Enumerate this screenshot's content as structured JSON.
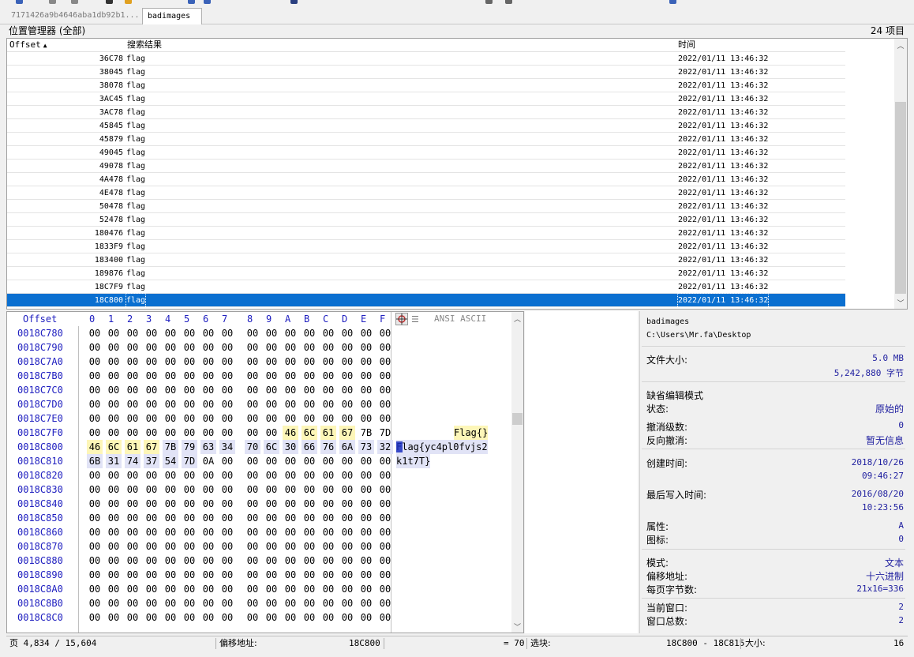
{
  "tabs": [
    {
      "label": "7171426a9b4646aba1db92b1..."
    },
    {
      "label": "badimages"
    }
  ],
  "position_manager": {
    "title": "位置管理器 (全部)",
    "count": "24 项目",
    "columns": [
      "Offset",
      "搜索结果",
      "时间"
    ],
    "rows": [
      {
        "offset": "36C78",
        "result": "flag",
        "time": "2022/01/11   13:46:32"
      },
      {
        "offset": "38045",
        "result": "flag",
        "time": "2022/01/11   13:46:32"
      },
      {
        "offset": "38078",
        "result": "flag",
        "time": "2022/01/11   13:46:32"
      },
      {
        "offset": "3AC45",
        "result": "flag",
        "time": "2022/01/11   13:46:32"
      },
      {
        "offset": "3AC78",
        "result": "flag",
        "time": "2022/01/11   13:46:32"
      },
      {
        "offset": "45845",
        "result": "flag",
        "time": "2022/01/11   13:46:32"
      },
      {
        "offset": "45879",
        "result": "flag",
        "time": "2022/01/11   13:46:32"
      },
      {
        "offset": "49045",
        "result": "flag",
        "time": "2022/01/11   13:46:32"
      },
      {
        "offset": "49078",
        "result": "flag",
        "time": "2022/01/11   13:46:32"
      },
      {
        "offset": "4A478",
        "result": "flag",
        "time": "2022/01/11   13:46:32"
      },
      {
        "offset": "4E478",
        "result": "flag",
        "time": "2022/01/11   13:46:32"
      },
      {
        "offset": "50478",
        "result": "flag",
        "time": "2022/01/11   13:46:32"
      },
      {
        "offset": "52478",
        "result": "flag",
        "time": "2022/01/11   13:46:32"
      },
      {
        "offset": "180476",
        "result": "flag",
        "time": "2022/01/11   13:46:32"
      },
      {
        "offset": "1833F9",
        "result": "flag",
        "time": "2022/01/11   13:46:32"
      },
      {
        "offset": "183400",
        "result": "flag",
        "time": "2022/01/11   13:46:32"
      },
      {
        "offset": "189876",
        "result": "flag",
        "time": "2022/01/11   13:46:32"
      },
      {
        "offset": "18C7F9",
        "result": "flag",
        "time": "2022/01/11   13:46:32"
      },
      {
        "offset": "18C800",
        "result": "flag",
        "time": "2022/01/11   13:46:32"
      }
    ]
  },
  "hex": {
    "offset_header": "Offset",
    "columns": [
      "0",
      "1",
      "2",
      "3",
      "4",
      "5",
      "6",
      "7",
      "8",
      "9",
      "A",
      "B",
      "C",
      "D",
      "E",
      "F"
    ],
    "ascii_header": "ANSI ASCII",
    "rows": [
      {
        "addr": "0018C780",
        "bytes": [
          "00",
          "00",
          "00",
          "00",
          "00",
          "00",
          "00",
          "00",
          "00",
          "00",
          "00",
          "00",
          "00",
          "00",
          "00",
          "00"
        ],
        "ascii": ""
      },
      {
        "addr": "0018C790",
        "bytes": [
          "00",
          "00",
          "00",
          "00",
          "00",
          "00",
          "00",
          "00",
          "00",
          "00",
          "00",
          "00",
          "00",
          "00",
          "00",
          "00"
        ],
        "ascii": ""
      },
      {
        "addr": "0018C7A0",
        "bytes": [
          "00",
          "00",
          "00",
          "00",
          "00",
          "00",
          "00",
          "00",
          "00",
          "00",
          "00",
          "00",
          "00",
          "00",
          "00",
          "00"
        ],
        "ascii": ""
      },
      {
        "addr": "0018C7B0",
        "bytes": [
          "00",
          "00",
          "00",
          "00",
          "00",
          "00",
          "00",
          "00",
          "00",
          "00",
          "00",
          "00",
          "00",
          "00",
          "00",
          "00"
        ],
        "ascii": ""
      },
      {
        "addr": "0018C7C0",
        "bytes": [
          "00",
          "00",
          "00",
          "00",
          "00",
          "00",
          "00",
          "00",
          "00",
          "00",
          "00",
          "00",
          "00",
          "00",
          "00",
          "00"
        ],
        "ascii": ""
      },
      {
        "addr": "0018C7D0",
        "bytes": [
          "00",
          "00",
          "00",
          "00",
          "00",
          "00",
          "00",
          "00",
          "00",
          "00",
          "00",
          "00",
          "00",
          "00",
          "00",
          "00"
        ],
        "ascii": ""
      },
      {
        "addr": "0018C7E0",
        "bytes": [
          "00",
          "00",
          "00",
          "00",
          "00",
          "00",
          "00",
          "00",
          "00",
          "00",
          "00",
          "00",
          "00",
          "00",
          "00",
          "00"
        ],
        "ascii": ""
      },
      {
        "addr": "0018C7F0",
        "bytes": [
          "00",
          "00",
          "00",
          "00",
          "00",
          "00",
          "00",
          "00",
          "00",
          "00",
          "46",
          "6C",
          "61",
          "67",
          "7B",
          "7D"
        ],
        "ascii": "Flag{}"
      },
      {
        "addr": "0018C800",
        "bytes": [
          "46",
          "6C",
          "61",
          "67",
          "7B",
          "79",
          "63",
          "34",
          "70",
          "6C",
          "30",
          "66",
          "76",
          "6A",
          "73",
          "32"
        ],
        "ascii": "Flag{yc4pl0fvjs2"
      },
      {
        "addr": "0018C810",
        "bytes": [
          "6B",
          "31",
          "74",
          "37",
          "54",
          "7D",
          "0A",
          "00",
          "00",
          "00",
          "00",
          "00",
          "00",
          "00",
          "00",
          "00"
        ],
        "ascii": "k1t7T}"
      },
      {
        "addr": "0018C820",
        "bytes": [
          "00",
          "00",
          "00",
          "00",
          "00",
          "00",
          "00",
          "00",
          "00",
          "00",
          "00",
          "00",
          "00",
          "00",
          "00",
          "00"
        ],
        "ascii": ""
      },
      {
        "addr": "0018C830",
        "bytes": [
          "00",
          "00",
          "00",
          "00",
          "00",
          "00",
          "00",
          "00",
          "00",
          "00",
          "00",
          "00",
          "00",
          "00",
          "00",
          "00"
        ],
        "ascii": ""
      },
      {
        "addr": "0018C840",
        "bytes": [
          "00",
          "00",
          "00",
          "00",
          "00",
          "00",
          "00",
          "00",
          "00",
          "00",
          "00",
          "00",
          "00",
          "00",
          "00",
          "00"
        ],
        "ascii": ""
      },
      {
        "addr": "0018C850",
        "bytes": [
          "00",
          "00",
          "00",
          "00",
          "00",
          "00",
          "00",
          "00",
          "00",
          "00",
          "00",
          "00",
          "00",
          "00",
          "00",
          "00"
        ],
        "ascii": ""
      },
      {
        "addr": "0018C860",
        "bytes": [
          "00",
          "00",
          "00",
          "00",
          "00",
          "00",
          "00",
          "00",
          "00",
          "00",
          "00",
          "00",
          "00",
          "00",
          "00",
          "00"
        ],
        "ascii": ""
      },
      {
        "addr": "0018C870",
        "bytes": [
          "00",
          "00",
          "00",
          "00",
          "00",
          "00",
          "00",
          "00",
          "00",
          "00",
          "00",
          "00",
          "00",
          "00",
          "00",
          "00"
        ],
        "ascii": ""
      },
      {
        "addr": "0018C880",
        "bytes": [
          "00",
          "00",
          "00",
          "00",
          "00",
          "00",
          "00",
          "00",
          "00",
          "00",
          "00",
          "00",
          "00",
          "00",
          "00",
          "00"
        ],
        "ascii": ""
      },
      {
        "addr": "0018C890",
        "bytes": [
          "00",
          "00",
          "00",
          "00",
          "00",
          "00",
          "00",
          "00",
          "00",
          "00",
          "00",
          "00",
          "00",
          "00",
          "00",
          "00"
        ],
        "ascii": ""
      },
      {
        "addr": "0018C8A0",
        "bytes": [
          "00",
          "00",
          "00",
          "00",
          "00",
          "00",
          "00",
          "00",
          "00",
          "00",
          "00",
          "00",
          "00",
          "00",
          "00",
          "00"
        ],
        "ascii": ""
      },
      {
        "addr": "0018C8B0",
        "bytes": [
          "00",
          "00",
          "00",
          "00",
          "00",
          "00",
          "00",
          "00",
          "00",
          "00",
          "00",
          "00",
          "00",
          "00",
          "00",
          "00"
        ],
        "ascii": ""
      },
      {
        "addr": "0018C8C0",
        "bytes": [
          "00",
          "00",
          "00",
          "00",
          "00",
          "00",
          "00",
          "00",
          "00",
          "00",
          "00",
          "00",
          "00",
          "00",
          "00",
          "00"
        ],
        "ascii": ""
      }
    ]
  },
  "info": {
    "file_name": "badimages",
    "path": "C:\\Users\\Mr.fa\\Desktop",
    "file_size_label": "文件大小:",
    "file_size_mb": "5.0 MB",
    "file_size_bytes": "5,242,880 字节",
    "edit_mode_title": "缺省编辑模式",
    "state_label": "状态:",
    "state_value": "原始的",
    "undo_level_label": "撤消级数:",
    "undo_level_value": "0",
    "redo_label": "反向撤消:",
    "redo_value": "暂无信息",
    "created_label": "创建时间:",
    "created_date": "2018/10/26",
    "created_time": "09:46:27",
    "modified_label": "最后写入时间:",
    "modified_date": "2016/08/20",
    "modified_time": "10:23:56",
    "attr_label": "属性:",
    "attr_value": "A",
    "icon_label": "图标:",
    "icon_value": "0",
    "mode_label": "模式:",
    "mode_value": "文本",
    "offset_addr_label": "偏移地址:",
    "offset_addr_value": "十六进制",
    "bytes_per_page_label": "每页字节数:",
    "bytes_per_page_value": "21x16=336",
    "current_window_label": "当前窗口:",
    "current_window_value": "2",
    "window_count_label": "窗口总数:",
    "window_count_value": "2"
  },
  "status": {
    "page": "页 4,834 / 15,604",
    "offset_label": "偏移地址:",
    "offset_value": "18C800",
    "eq_value": "= 70",
    "selection_label": "选块:",
    "selection_value": "18C800 - 18C815",
    "size_label": "大小:",
    "size_value": "16"
  },
  "colors": {
    "selection": "#0a6fd0",
    "highlight_yellow": "#fdf6b8",
    "highlight_blue": "#e1e3f6",
    "address": "#2020c0"
  }
}
